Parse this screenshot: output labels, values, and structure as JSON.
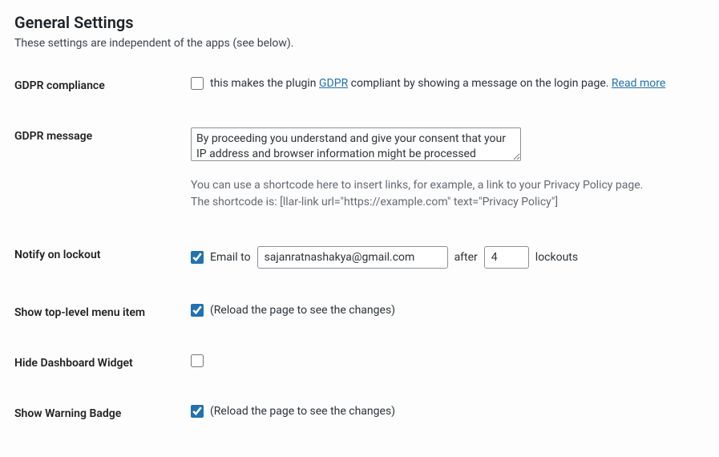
{
  "section": {
    "title": "General Settings",
    "description": "These settings are independent of the apps (see below)."
  },
  "rows": {
    "gdpr_compliance": {
      "label": "GDPR compliance",
      "checked": false,
      "text_prefix": "this makes the plugin ",
      "gdpr_link_text": "GDPR",
      "text_suffix": " compliant by showing a message on the login page. ",
      "read_more": "Read more"
    },
    "gdpr_message": {
      "label": "GDPR message",
      "value": "By proceeding you understand and give your consent that your IP address and browser information might be processed",
      "help_line1": "You can use a shortcode here to insert links, for example, a link to your Privacy Policy page.",
      "help_line2": "The shortcode is: [llar-link url=\"https://example.com\" text=\"Privacy Policy\"]"
    },
    "notify": {
      "label": "Notify on lockout",
      "checked": true,
      "email_to_label": "Email to",
      "email_value": "sajanratnashakya@gmail.com",
      "after_label": "after",
      "lockouts_value": "4",
      "lockouts_label": "lockouts"
    },
    "top_menu": {
      "label": "Show top-level menu item",
      "checked": true,
      "note": "(Reload the page to see the changes)"
    },
    "hide_widget": {
      "label": "Hide Dashboard Widget",
      "checked": false
    },
    "warning_badge": {
      "label": "Show Warning Badge",
      "checked": true,
      "note": "(Reload the page to see the changes)"
    }
  }
}
